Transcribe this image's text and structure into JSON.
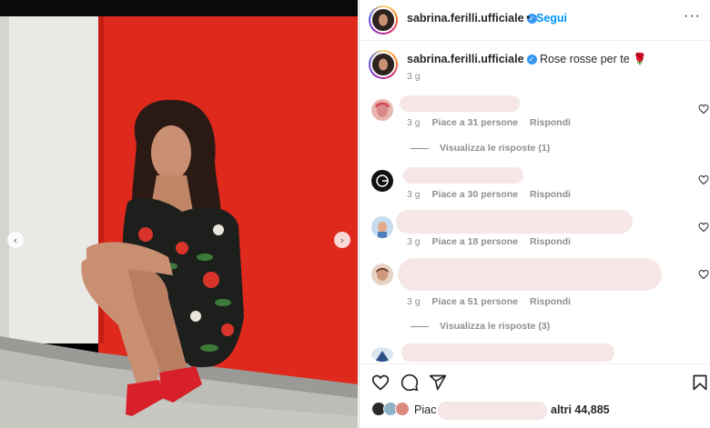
{
  "header": {
    "username": "sabrina.ferilli.ufficiale",
    "separator": "•",
    "follow_label": "Segui",
    "more_label": "···"
  },
  "caption": {
    "username": "sabrina.ferilli.ufficiale",
    "text": "Rose rosse per te",
    "emoji": "🌹",
    "time": "3 g"
  },
  "comments": [
    {
      "time": "3 g",
      "likes": "Piace a 31 persone",
      "reply": "Rispondi",
      "view_replies": "Visualizza le risposte (1)"
    },
    {
      "time": "3 g",
      "likes": "Piace a 30 persone",
      "reply": "Rispondi"
    },
    {
      "time": "3 g",
      "likes": "Piace a 18 persone",
      "reply": "Rispondi"
    },
    {
      "time": "3 g",
      "likes": "Piace a 51 persone",
      "reply": "Rispondi",
      "view_replies": "Visualizza le risposte (3)"
    }
  ],
  "likes": {
    "prefix": "Piac",
    "suffix": "altri 44,885"
  },
  "colors": {
    "accent": "#0095f6",
    "verified": "#3897f0",
    "wall_red": "#e0291d",
    "blur": "#f6e6e6"
  },
  "icons": [
    "chevron-left-icon",
    "chevron-right-icon",
    "verified-icon",
    "heart-icon",
    "comment-icon",
    "share-icon",
    "bookmark-icon"
  ]
}
